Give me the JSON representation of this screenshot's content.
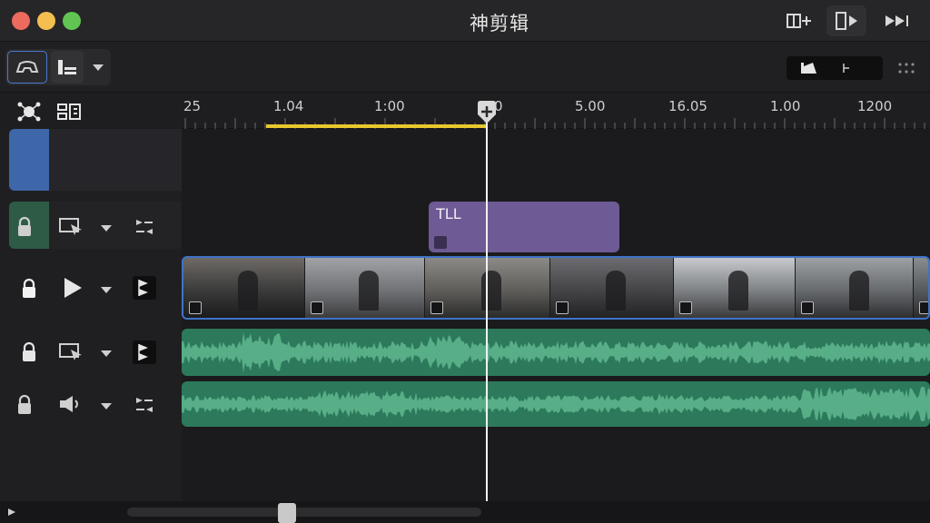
{
  "window": {
    "title": "神剪辑",
    "traffic_colors": [
      "#ed6a5e",
      "#f5bf4f",
      "#61c554"
    ]
  },
  "toolbar": {
    "mode_icons": [
      "overview-icon",
      "track-layout-icon",
      "chevron-down-icon"
    ],
    "view_icons": [
      "clip-view-icon",
      "marker-view-icon"
    ]
  },
  "titlebar_actions": [
    "add-track-icon",
    "layout-toggle-icon",
    "fast-forward-icon"
  ],
  "ruler": {
    "labels": [
      {
        "text": "25"
      },
      {
        "text": "1.04"
      },
      {
        "text": "1:00"
      },
      {
        "text": "0"
      },
      {
        "text": "5.00"
      },
      {
        "text": "16.05"
      },
      {
        "text": "1.00"
      },
      {
        "text": "1200"
      }
    ],
    "range_color": "#e7c72b"
  },
  "tracks": {
    "title_track": {
      "clip_label": "TLL"
    },
    "video_track": {
      "thumb_count": 7
    },
    "audio_colors": [
      "#2c7a5b",
      "#2c7a5b"
    ]
  }
}
